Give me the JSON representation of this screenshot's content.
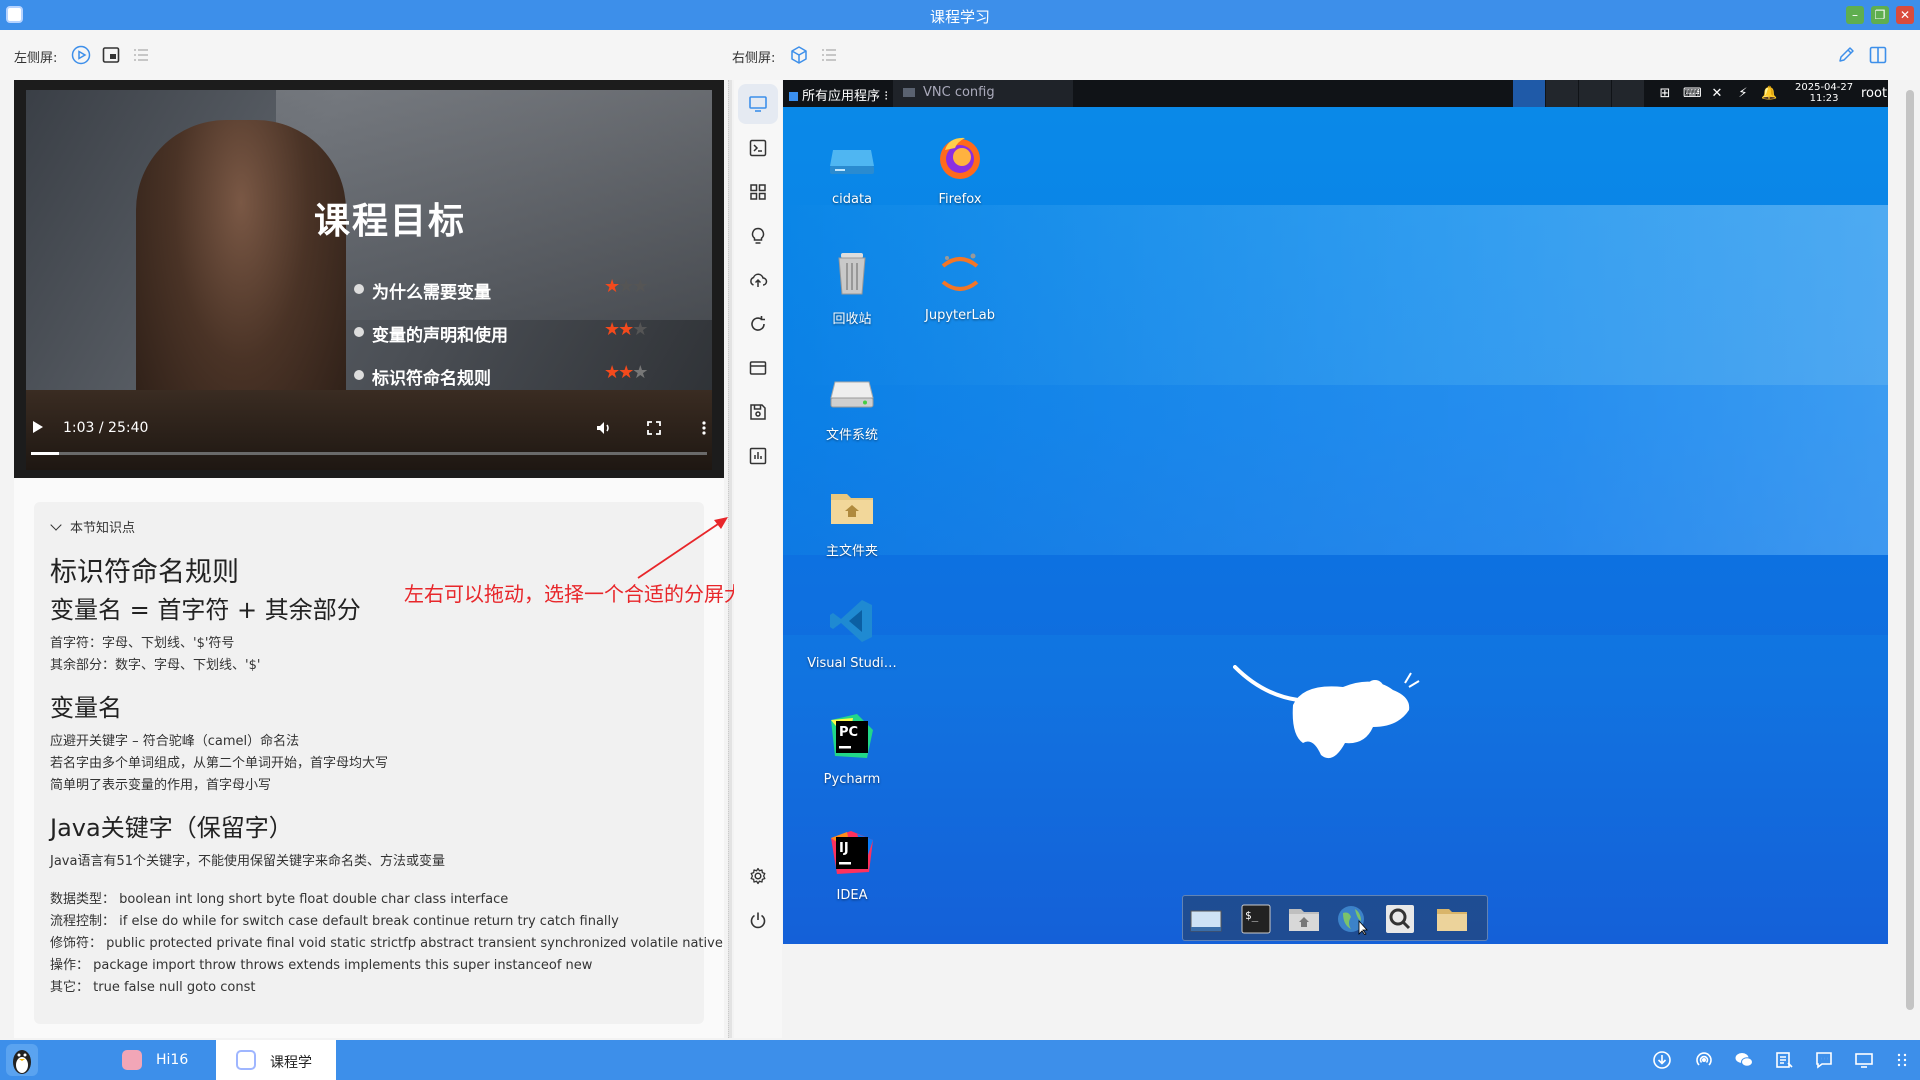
{
  "window": {
    "title": "课程学习"
  },
  "toolbar": {
    "left_label": "左侧屏:",
    "right_label": "右侧屏:"
  },
  "video": {
    "slide_title": "课程目标",
    "goals": [
      {
        "text": "为什么需要变量",
        "stars": 1
      },
      {
        "text": "变量的声明和使用",
        "stars": 2
      },
      {
        "text": "标识符命名规则",
        "stars": 2
      }
    ],
    "time": "1:03 / 25:40",
    "progress": 0.041
  },
  "notes": {
    "header": "本节知识点",
    "h_rules": "标识符命名规则",
    "h_varname_formula": "变量名 = 首字符 + 其余部分",
    "p_first_char": "首字符：字母、下划线、'$'符号",
    "p_rest": "其余部分：数字、字母、下划线、'$'",
    "h_varname": "变量名",
    "p_avoid": "应避开关键字 – 符合驼峰（camel）命名法",
    "p_multi": "若名字由多个单词组成，从第二个单词开始，首字母均大写",
    "p_simple": "简单明了表示变量的作用，首字母小写",
    "h_keywords": "Java关键字（保留字）",
    "p_keyword_count": "Java语言有51个关键字，不能使用保留关键字来命名类、方法或变量",
    "p_types": "数据类型：  boolean int long short byte float double char class interface",
    "p_flow": "流程控制：  if else do while for switch case default break continue return try catch finally",
    "p_modifiers": "修饰符：  public protected private final void static strictfp abstract transient synchronized volatile native",
    "p_ops": "操作：  package import throw throws extends implements this super instanceof new",
    "p_other": "其它：  true false null goto const"
  },
  "annotation": "左右可以拖动，选择一个合适的分屏大小",
  "desktop": {
    "panel": {
      "apps_menu": "所有应用程序 ⁝",
      "task": "VNC config",
      "date": "2025-04-27",
      "time": "11:23",
      "user": "root"
    },
    "icons": [
      {
        "label": "cidata"
      },
      {
        "label": "Firefox"
      },
      {
        "label": "回收站"
      },
      {
        "label": "JupyterLab"
      },
      {
        "label": "文件系统"
      },
      {
        "label": "主文件夹"
      },
      {
        "label": "Visual Studi…"
      },
      {
        "label": "Pycharm"
      },
      {
        "label": "IDEA"
      }
    ]
  },
  "taskbar": {
    "tasks": [
      {
        "label": "Hi16"
      },
      {
        "label": "课程学"
      }
    ]
  },
  "colors": {
    "accent": "#3d8fea",
    "annotation": "#e8262a",
    "star": "#f44a1c"
  }
}
